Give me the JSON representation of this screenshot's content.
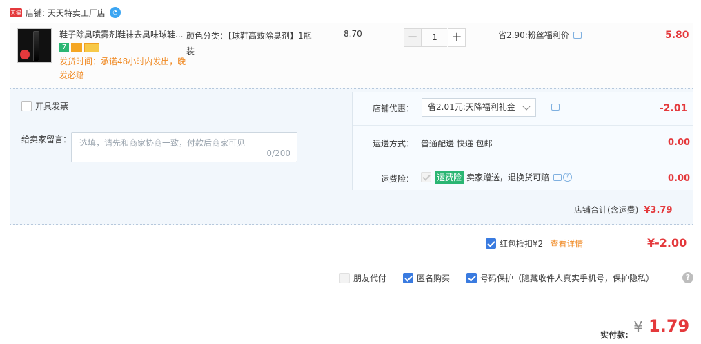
{
  "shop": {
    "badge": "天猫",
    "label": "店铺: 天天特卖工厂店",
    "ww_icon": "chat-bubble-icon"
  },
  "item": {
    "title": "鞋子除臭喷雾剂鞋袜去臭味球鞋...",
    "icon7": "7",
    "ship_note": "发货时间：承诺48小时内发出，晚发必赔",
    "sku": "颜色分类：【球鞋高效除臭剂】1瓶装",
    "unit_price": "8.70",
    "qty": {
      "minus": "−",
      "value": "1",
      "plus": "+"
    },
    "discount_note": "省2.90:粉丝福利价",
    "total": "5.80"
  },
  "extras": {
    "invoice_label": "开具发票",
    "message_label": "给卖家留言：",
    "message_placeholder": "选填，请先和商家协商一致，付款后商家可见",
    "message_count": "0/200",
    "shop_promo_label": "店铺优惠：",
    "shop_promo_value": "省2.01元:天降福利礼金",
    "shop_promo_amount": "-2.01",
    "shipping_label": "运送方式：",
    "shipping_value": "普通配送 快递 包邮",
    "shipping_amount": "0.00",
    "insurance_label": "运费险：",
    "insurance_badge": "运费险",
    "insurance_text": "卖家赠送，退换货可赔",
    "insurance_amount": "0.00",
    "shop_total_label": "店铺合计(含运费)",
    "shop_total_amount": "¥3.79"
  },
  "red_packet": {
    "label": "红包抵扣¥2",
    "link": "查看详情",
    "amount": "¥-2.00"
  },
  "options": {
    "friend_pay": "朋友代付",
    "anonymous": "匿名购买",
    "number_protect": "号码保护（隐藏收件人真实手机号，保护隐私）",
    "help": "?"
  },
  "pay": {
    "label": "实付款:",
    "currency": "¥",
    "amount": "1.79"
  },
  "colors": {
    "accent_red": "#e4393c",
    "link_orange": "#f08a24",
    "check_blue": "#3a7be0",
    "green_badge": "#2bb673"
  }
}
